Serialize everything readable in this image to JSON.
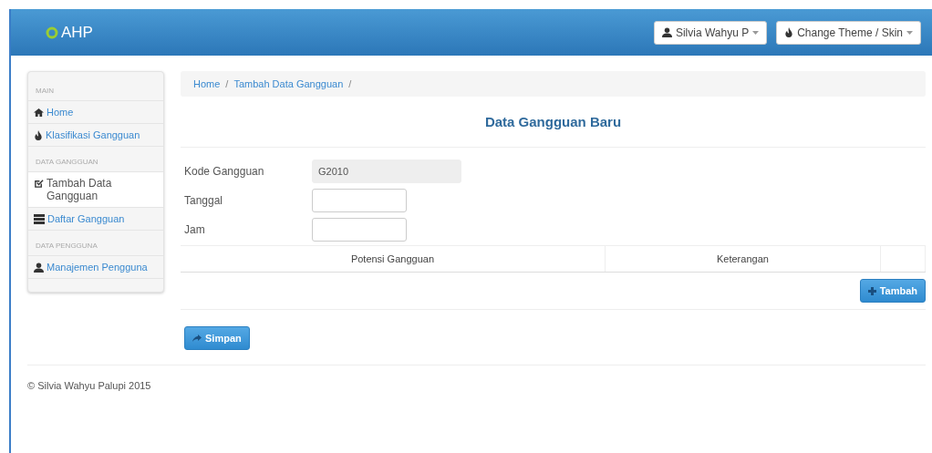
{
  "header": {
    "brand": "AHP",
    "user_menu": "Silvia Wahyu P",
    "theme_menu": "Change Theme / Skin"
  },
  "sidebar": {
    "items": [
      {
        "kind": "section",
        "label": "MAIN"
      },
      {
        "kind": "link",
        "label": "Home",
        "selected": false
      },
      {
        "kind": "link",
        "label": "Klasifikasi Gangguan",
        "selected": false
      },
      {
        "kind": "section",
        "label": "DATA GANGGUAN"
      },
      {
        "kind": "link",
        "label": "Tambah Data Gangguan",
        "selected": true
      },
      {
        "kind": "link",
        "label": "Daftar Gangguan",
        "selected": false
      },
      {
        "kind": "section",
        "label": "DATA PENGGUNA"
      },
      {
        "kind": "link",
        "label": "Manajemen Pengguna",
        "selected": false
      }
    ]
  },
  "breadcrumb": [
    {
      "label": "Home",
      "separator": "/"
    },
    {
      "label": "Tambah Data Gangguan",
      "separator": "/"
    }
  ],
  "form": {
    "title": "Data Gangguan Baru",
    "fields": [
      {
        "label": "Kode Gangguan",
        "value": "G2010",
        "disabled": true
      },
      {
        "label": "Tanggal",
        "disabled": false
      },
      {
        "label": "Jam",
        "disabled": false
      }
    ],
    "table": {
      "columns": [
        "Potensi Gangguan",
        "Keterangan"
      ]
    },
    "add_button": "Tambah",
    "save_button": "Simpan"
  },
  "footer": "© Silvia Wahyu Palupi 2015"
}
